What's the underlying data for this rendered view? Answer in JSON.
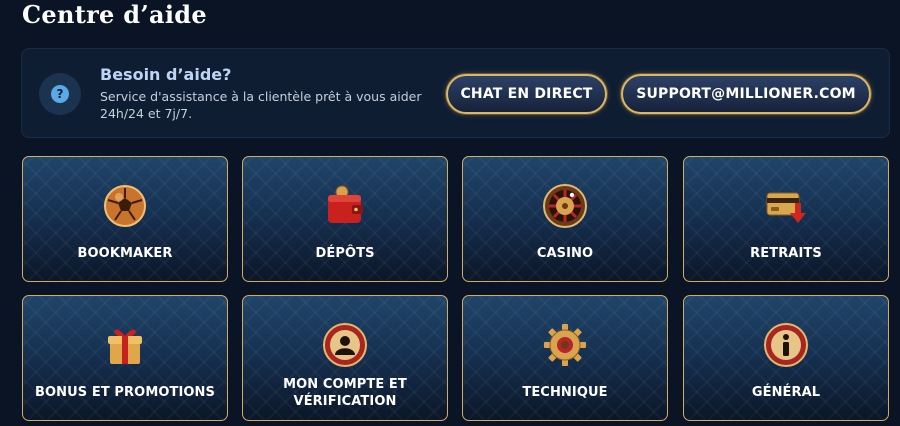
{
  "page": {
    "title": "Centre d’aide"
  },
  "help": {
    "icon": "question-icon",
    "title": "Besoin d’aide?",
    "text": "Service d'assistance à la clientèle prêt à vous aider 24h/24 et 7j/7.",
    "chat_label": "CHAT EN DIRECT",
    "email_label": "SUPPORT@MILLIONER.COM"
  },
  "categories": [
    {
      "label": "BOOKMAKER",
      "icon": "soccer-ball-icon"
    },
    {
      "label": "DÉPÔTS",
      "icon": "wallet-icon"
    },
    {
      "label": "CASINO",
      "icon": "roulette-icon"
    },
    {
      "label": "RETRAITS",
      "icon": "card-withdraw-icon"
    },
    {
      "label": "BONUS ET PROMOTIONS",
      "icon": "gift-icon"
    },
    {
      "label": "MON COMPTE ET VÉRIFICATION",
      "icon": "user-icon"
    },
    {
      "label": "TECHNIQUE",
      "icon": "gear-icon"
    },
    {
      "label": "GÉNÉRAL",
      "icon": "info-icon"
    }
  ],
  "colors": {
    "background": "#0a1424",
    "panel": "#0f1d33",
    "accent_gold": "#d9b86a",
    "card_top": "#1f4569"
  }
}
